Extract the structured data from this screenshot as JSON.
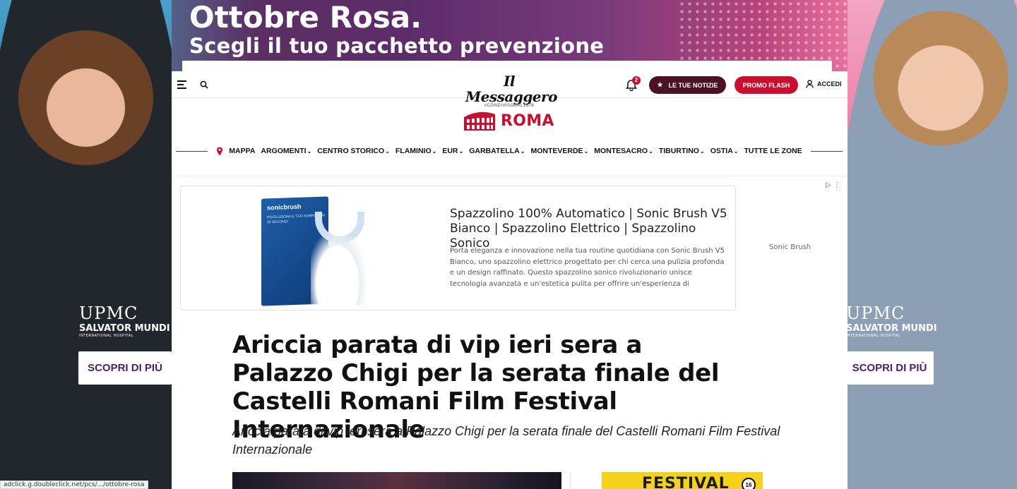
{
  "skin_ad": {
    "headline": "Ottobre Rosa.",
    "subline": "Scegli il tuo pacchetto prevenzione",
    "brand": "UPMC",
    "hospital": "SALVATOR MUNDI",
    "hospital_sub": "INTERNATIONAL HOSPITAL",
    "cta": "SCOPRI DI PIÙ",
    "status_url": "adclick.g.doubleclick.net/pcs/.../ottobre-rosa"
  },
  "header": {
    "logo": "Il Messaggero",
    "logo_tagline": "#CONDIVISODAL1878",
    "notification_count": "2",
    "news_button": "LE TUE NOTIZIE",
    "promo_button": "PROMO FLASH",
    "login": "ACCEDI"
  },
  "section": {
    "title": "ROMA",
    "nav": [
      {
        "label": "MAPPA",
        "dropdown": false
      },
      {
        "label": "ARGOMENTI",
        "dropdown": true
      },
      {
        "label": "CENTRO STORICO",
        "dropdown": true
      },
      {
        "label": "FLAMINIO",
        "dropdown": true
      },
      {
        "label": "EUR",
        "dropdown": true
      },
      {
        "label": "GARBATELLA",
        "dropdown": true
      },
      {
        "label": "MONTEVERDE",
        "dropdown": true
      },
      {
        "label": "MONTESACRO",
        "dropdown": true
      },
      {
        "label": "TIBURTINO",
        "dropdown": true
      },
      {
        "label": "OSTIA",
        "dropdown": true
      },
      {
        "label": "TUTTE LE ZONE",
        "dropdown": false
      }
    ]
  },
  "sponsored": {
    "product_box_name": "sonicbrush",
    "product_box_text": "RIVOLUZIONA IL TUO SORRISO IN 30 SECONDI",
    "title": "Spazzolino 100% Automatico | Sonic Brush V5 Bianco | Spazzolino Elettrico | Spazzolino Sonico",
    "description": "Porta eleganza e innovazione nella tua routine quotidiana con Sonic Brush V5 Bianco, uno spazzolino elettrico progettato per chi cerca una pulizia profonda e un design raffinato. Questo spazzolino sonico rivoluzionario unisce tecnologia avanzata e un'estetica pulita per offrire un'esperienza di spazzolamento senza...",
    "advertiser": "Sonic Brush"
  },
  "article": {
    "headline": "Ariccia parata di vip ieri sera a Palazzo Chigi per la serata finale del Castelli Romani Film Festival Internazionale",
    "subheadline": "Ariccia parata di vip ieri sera a Palazzo Chigi per la serata finale del Castelli Romani Film Festival Internazionale"
  },
  "side_ad": {
    "text": "FESTIVAL",
    "badge": "16"
  },
  "colors": {
    "brand_red": "#c8102e",
    "dark_maroon": "#4a1224",
    "festival_yellow": "#f4d21b",
    "ad_purple": "#4a2366"
  }
}
